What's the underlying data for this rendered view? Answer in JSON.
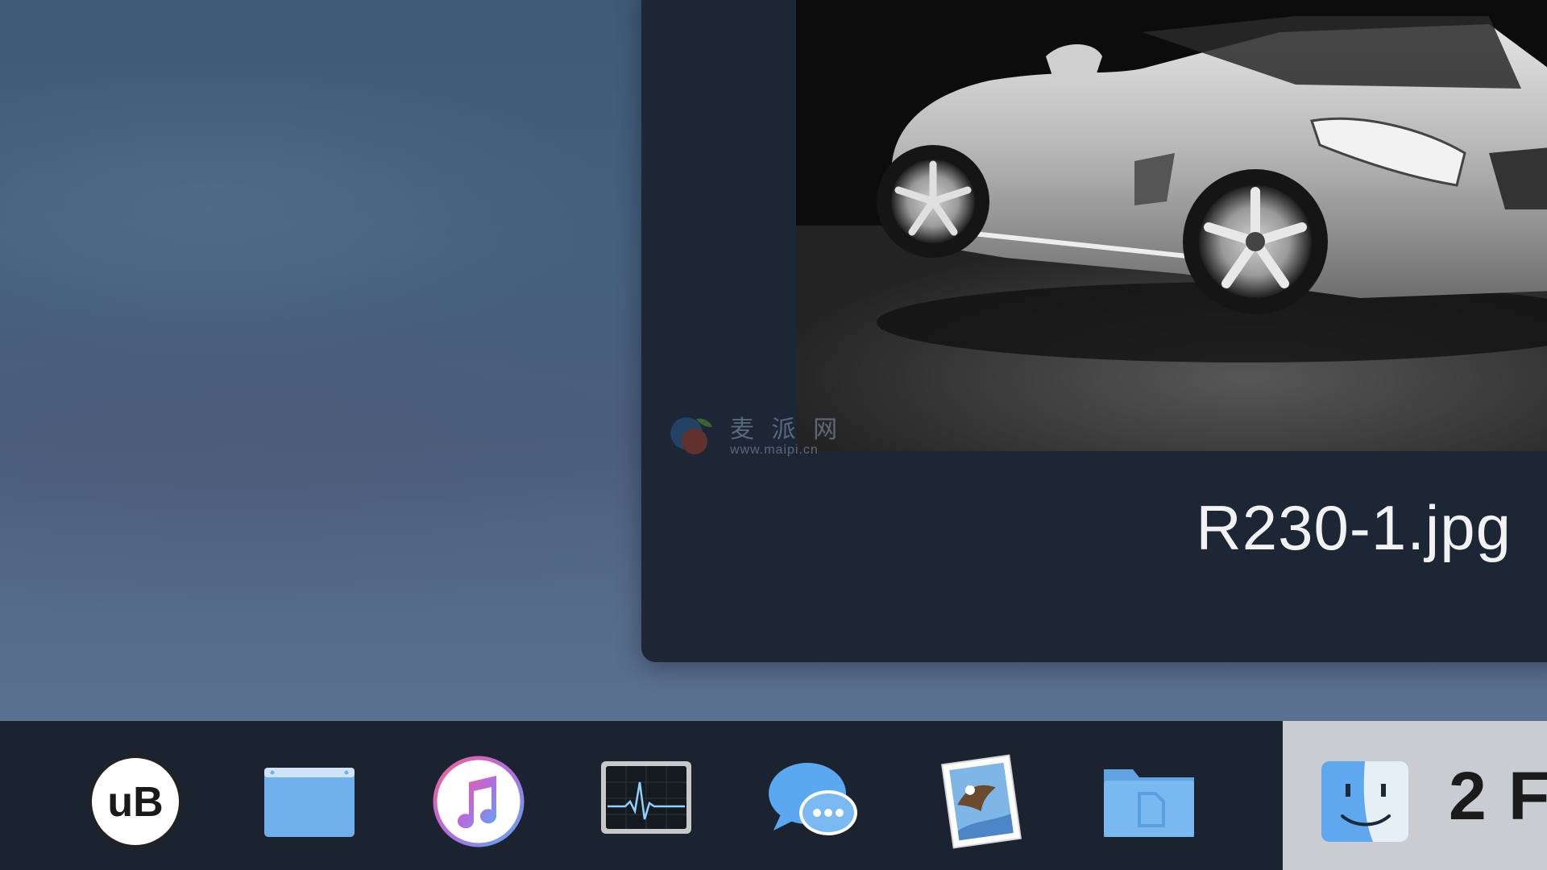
{
  "preview": {
    "filename": "R230-1.jpg"
  },
  "watermark": {
    "text": "麦 派 网",
    "url": "www.maipi.cn"
  },
  "dock": {
    "items": [
      {
        "name": "ublock-app",
        "label": "uB"
      },
      {
        "name": "browser-window-app"
      },
      {
        "name": "itunes-app"
      },
      {
        "name": "activity-monitor-app"
      },
      {
        "name": "messages-app"
      },
      {
        "name": "mail-app"
      },
      {
        "name": "documents-folder"
      },
      {
        "name": "finder-app"
      }
    ],
    "finder_label": "2 F"
  },
  "colors": {
    "desktop": "#3f5a78",
    "panel": "#1c2634",
    "dock": "#1b2331",
    "finder_highlight": "#c9ccd0",
    "folder_blue": "#6fb0ec"
  }
}
